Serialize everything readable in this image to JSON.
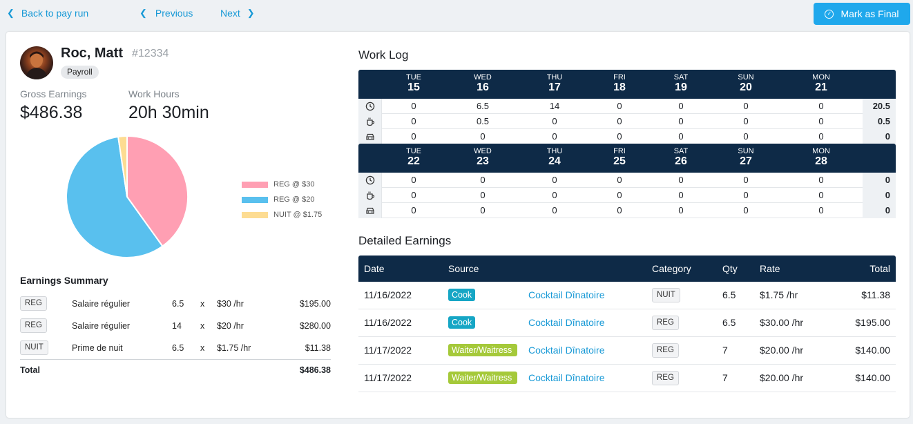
{
  "nav": {
    "back_label": "Back to pay run",
    "previous_label": "Previous",
    "next_label": "Next",
    "final_label": "Mark as Final"
  },
  "employee": {
    "name": "Roc, Matt",
    "number": "#12334",
    "group": "Payroll"
  },
  "stats": {
    "gross_label": "Gross Earnings",
    "gross_value": "$486.38",
    "hours_label": "Work Hours",
    "hours_value": "20h 30min"
  },
  "chart_data": {
    "type": "pie",
    "slices": [
      {
        "label": "REG @ $30",
        "value": 195.0,
        "color": "#ff9fb3"
      },
      {
        "label": "REG @ $20",
        "value": 280.0,
        "color": "#59c0ee"
      },
      {
        "label": "NUIT @ $1.75",
        "value": 11.38,
        "color": "#fddc92"
      }
    ],
    "legend_position": "right"
  },
  "summary": {
    "title": "Earnings Summary",
    "rows": [
      {
        "tag": "REG",
        "desc": "Salaire régulier",
        "qty": "6.5",
        "x": "x",
        "rate": "$30 /hr",
        "amount": "$195.00"
      },
      {
        "tag": "REG",
        "desc": "Salaire régulier",
        "qty": "14",
        "x": "x",
        "rate": "$20 /hr",
        "amount": "$280.00"
      },
      {
        "tag": "NUIT",
        "desc": "Prime de nuit",
        "qty": "6.5",
        "x": "x",
        "rate": "$1.75 /hr",
        "amount": "$11.38"
      }
    ],
    "total_label": "Total",
    "total_value": "$486.38"
  },
  "worklog": {
    "title": "Work Log",
    "icons": [
      "clock-icon",
      "coffee-icon",
      "car-icon"
    ],
    "weeks": [
      {
        "days": [
          {
            "dn": "TUE",
            "dd": "15"
          },
          {
            "dn": "WED",
            "dd": "16"
          },
          {
            "dn": "THU",
            "dd": "17"
          },
          {
            "dn": "FRI",
            "dd": "18"
          },
          {
            "dn": "SAT",
            "dd": "19"
          },
          {
            "dn": "SUN",
            "dd": "20"
          },
          {
            "dn": "MON",
            "dd": "21"
          }
        ],
        "rows": [
          {
            "values": [
              "0",
              "6.5",
              "14",
              "0",
              "0",
              "0",
              "0"
            ],
            "total": "20.5"
          },
          {
            "values": [
              "0",
              "0.5",
              "0",
              "0",
              "0",
              "0",
              "0"
            ],
            "total": "0.5"
          },
          {
            "values": [
              "0",
              "0",
              "0",
              "0",
              "0",
              "0",
              "0"
            ],
            "total": "0"
          }
        ]
      },
      {
        "days": [
          {
            "dn": "TUE",
            "dd": "22"
          },
          {
            "dn": "WED",
            "dd": "23"
          },
          {
            "dn": "THU",
            "dd": "24"
          },
          {
            "dn": "FRI",
            "dd": "25"
          },
          {
            "dn": "SAT",
            "dd": "26"
          },
          {
            "dn": "SUN",
            "dd": "27"
          },
          {
            "dn": "MON",
            "dd": "28"
          }
        ],
        "rows": [
          {
            "values": [
              "0",
              "0",
              "0",
              "0",
              "0",
              "0",
              "0"
            ],
            "total": "0"
          },
          {
            "values": [
              "0",
              "0",
              "0",
              "0",
              "0",
              "0",
              "0"
            ],
            "total": "0"
          },
          {
            "values": [
              "0",
              "0",
              "0",
              "0",
              "0",
              "0",
              "0"
            ],
            "total": "0"
          }
        ]
      }
    ]
  },
  "earnings": {
    "title": "Detailed Earnings",
    "headers": {
      "date": "Date",
      "source": "Source",
      "category": "Category",
      "qty": "Qty",
      "rate": "Rate",
      "total": "Total"
    },
    "rows": [
      {
        "date": "11/16/2022",
        "role": "Cook",
        "role_kind": "cook",
        "source": "Cocktail Dînatoire",
        "category": "NUIT",
        "qty": "6.5",
        "rate": "$1.75 /hr",
        "total": "$11.38"
      },
      {
        "date": "11/16/2022",
        "role": "Cook",
        "role_kind": "cook",
        "source": "Cocktail Dînatoire",
        "category": "REG",
        "qty": "6.5",
        "rate": "$30.00 /hr",
        "total": "$195.00"
      },
      {
        "date": "11/17/2022",
        "role": "Waiter/Waitress",
        "role_kind": "waiter",
        "source": "Cocktail Dînatoire",
        "category": "REG",
        "qty": "7",
        "rate": "$20.00 /hr",
        "total": "$140.00"
      },
      {
        "date": "11/17/2022",
        "role": "Waiter/Waitress",
        "role_kind": "waiter",
        "source": "Cocktail Dînatoire",
        "category": "REG",
        "qty": "7",
        "rate": "$20.00 /hr",
        "total": "$140.00"
      }
    ]
  }
}
